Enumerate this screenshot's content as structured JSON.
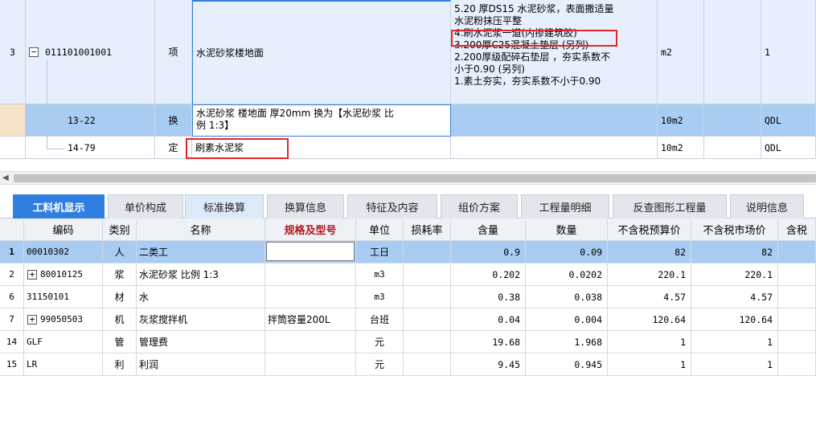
{
  "top_rows": [
    {
      "row_no": "3",
      "code": "011101001001",
      "type": "项",
      "name": "水泥砂浆楼地面",
      "description": [
        "5.20 厚DS15 水泥砂浆，表面撒适量",
        "水泥粉抹压平整",
        "4.刷水泥浆一道(内掺建筑胶)",
        "3.200厚C25混凝土垫层 (另列)",
        "2.200厚级配碎石垫层 ，夯实系数不",
        "小于0.90 (另列)",
        "1.素土夯实，夯实系数不小于0.90"
      ],
      "unit": "m2",
      "qty_expr": "1"
    },
    {
      "row_no": "",
      "code": "13-22",
      "type": "换",
      "name_line1": "水泥砂浆 楼地面 厚20mm  换为【水泥砂浆 比",
      "name_line2": "例 1:3】",
      "unit": "10m2",
      "qty_expr": "QDL"
    },
    {
      "row_no": "",
      "code": "14-79",
      "type": "定",
      "name": "刷素水泥浆",
      "unit": "10m2",
      "qty_expr": "QDL"
    }
  ],
  "tabs": [
    "工料机显示",
    "单价构成",
    "标准换算",
    "换算信息",
    "特征及内容",
    "组价方案",
    "工程量明细",
    "反查图形工程量",
    "说明信息"
  ],
  "columns": [
    "编码",
    "类别",
    "名称",
    "规格及型号",
    "单位",
    "损耗率",
    "含量",
    "数量",
    "不含税预算价",
    "不含税市场价",
    "含税"
  ],
  "rows": [
    {
      "no": "1",
      "code": "00010302",
      "category": "人",
      "name": "二类工",
      "spec": "",
      "unit": "工日",
      "loss": "",
      "content": "0.9",
      "qty": "0.09",
      "budget": "82",
      "market": "82"
    },
    {
      "no": "2",
      "code": "80010125",
      "category": "浆",
      "name": "水泥砂浆 比例 1:3",
      "spec": "",
      "unit": "m3",
      "loss": "",
      "content": "0.202",
      "qty": "0.0202",
      "budget": "220.1",
      "market": "220.1"
    },
    {
      "no": "6",
      "code": "31150101",
      "category": "材",
      "name": "水",
      "spec": "",
      "unit": "m3",
      "loss": "",
      "content": "0.38",
      "qty": "0.038",
      "budget": "4.57",
      "market": "4.57"
    },
    {
      "no": "7",
      "code": "99050503",
      "category": "机",
      "name": "灰浆搅拌机",
      "spec": "拌筒容量200L",
      "unit": "台班",
      "loss": "",
      "content": "0.04",
      "qty": "0.004",
      "budget": "120.64",
      "market": "120.64"
    },
    {
      "no": "14",
      "code": "GLF",
      "category": "管",
      "name": "管理费",
      "spec": "",
      "unit": "元",
      "loss": "",
      "content": "19.68",
      "qty": "1.968",
      "budget": "1",
      "market": "1"
    },
    {
      "no": "15",
      "code": "LR",
      "category": "利",
      "name": "利润",
      "spec": "",
      "unit": "元",
      "loss": "",
      "content": "9.45",
      "qty": "0.945",
      "budget": "1",
      "market": "1"
    }
  ],
  "colors": {
    "accent": "#2f7ee0",
    "selection": "#a9ccf2",
    "highlight_box": "#e0262c"
  }
}
